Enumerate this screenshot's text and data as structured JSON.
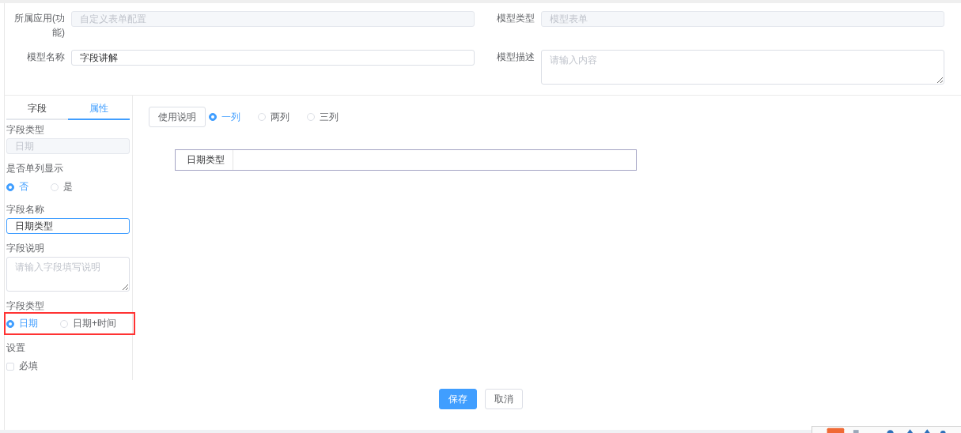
{
  "header_form": {
    "fields": [
      {
        "kind": "input",
        "label": "所属应用(功能)",
        "value": "自定义表单配置",
        "disabled": true
      },
      {
        "kind": "input",
        "label": "模型类型",
        "value": "模型表单",
        "disabled": true
      },
      {
        "kind": "input",
        "label": "模型名称",
        "value": "字段讲解",
        "disabled": false
      },
      {
        "kind": "textarea",
        "label": "模型描述",
        "placeholder": "请输入内容"
      }
    ]
  },
  "side_tabs": [
    {
      "label": "字段",
      "selected": false
    },
    {
      "label": "属性",
      "selected": true
    }
  ],
  "properties": [
    {
      "kind": "input",
      "label": "字段类型",
      "value": "日期",
      "disabled": true,
      "focused": false
    },
    {
      "kind": "radio",
      "label": "是否单列显示",
      "highlighted": false,
      "options": [
        {
          "label": "否",
          "selected": true
        },
        {
          "label": "是",
          "selected": false
        }
      ]
    },
    {
      "kind": "input",
      "label": "字段名称",
      "value": "日期类型",
      "disabled": false,
      "focused": true
    },
    {
      "kind": "textarea",
      "label": "字段说明",
      "placeholder": "请输入字段填写说明"
    },
    {
      "kind": "radio",
      "label": "字段类型",
      "highlighted": true,
      "options": [
        {
          "label": "日期",
          "selected": true
        },
        {
          "label": "日期+时间",
          "selected": false
        }
      ]
    },
    {
      "kind": "checkbox",
      "label": "设置",
      "options": [
        {
          "label": "必填",
          "checked": false
        }
      ]
    }
  ],
  "toolbar": {
    "help_button": "使用说明",
    "columns": [
      {
        "label": "一列",
        "selected": true
      },
      {
        "label": "两列",
        "selected": false
      },
      {
        "label": "三列",
        "selected": false
      }
    ]
  },
  "canvas": {
    "fields": [
      {
        "label": "日期类型"
      }
    ]
  },
  "buttons": [
    {
      "label": "保存",
      "kind": "primary"
    },
    {
      "label": "取消",
      "kind": "default"
    }
  ]
}
